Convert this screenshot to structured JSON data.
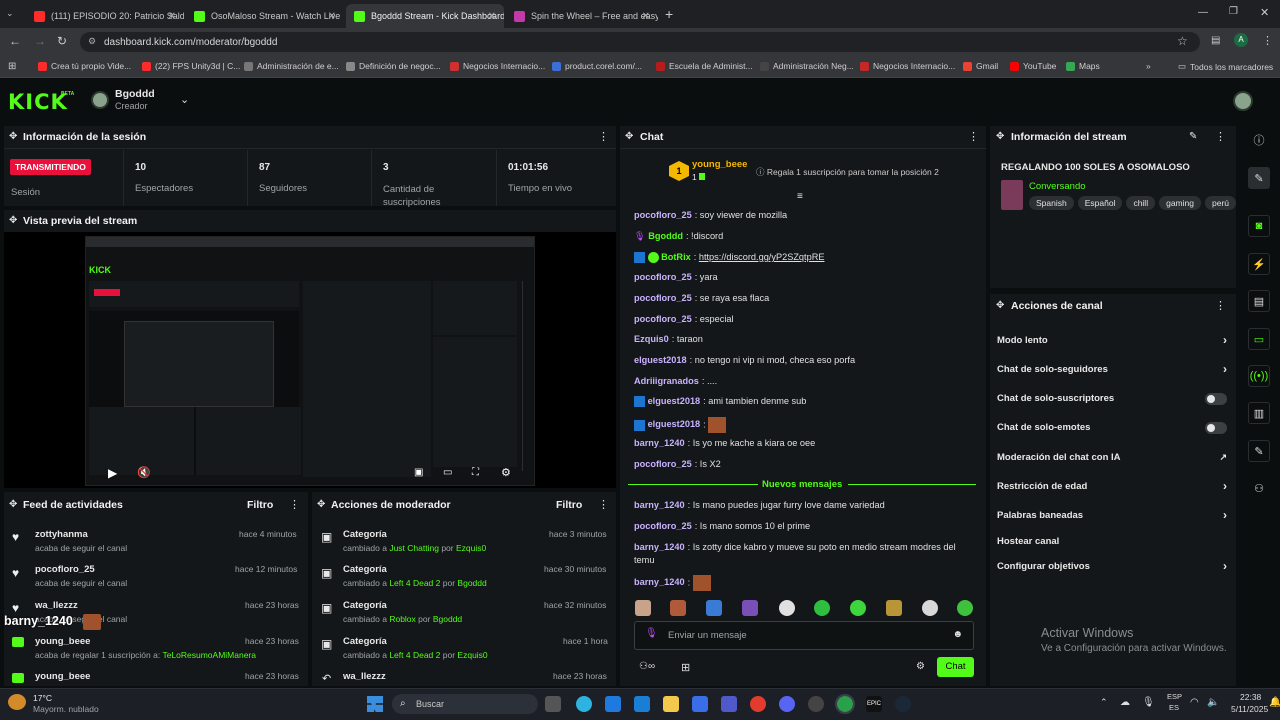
{
  "browser": {
    "tabs": [
      {
        "title": "(111) EPISODIO 20: Patricio Sald",
        "color": "#ff2b2b"
      },
      {
        "title": "OsoMaloso Stream - Watch Live",
        "color": "#53fc18"
      },
      {
        "title": "Bgoddd Stream - Kick Dashboard",
        "color": "#53fc18"
      },
      {
        "title": "Spin the Wheel – Free and easy",
        "color": "#c23aa8"
      }
    ],
    "url": "dashboard.kick.com/moderator/bgoddd",
    "bookmarks": [
      "Crea tú propio Vide...",
      "(22) FPS Unity3d | C...",
      "Administración de e...",
      "Definición de negoc...",
      "Negocios Internacio...",
      "product.corel.com/...",
      "Escuela de Administ...",
      "Administración Neg...",
      "Negocios Internacio...",
      "Gmail",
      "YouTube",
      "Maps"
    ],
    "bookmarks_folder": "Todos los marcadores"
  },
  "header": {
    "logo": "KICK",
    "logo_badge": "BETA",
    "user": "Bgoddd",
    "role": "Creador"
  },
  "session": {
    "title": "Información de la sesión",
    "status_badge": "TRANSMITIENDO",
    "status_label": "Sesión",
    "stats": [
      {
        "value": "10",
        "label": "Espectadores"
      },
      {
        "value": "87",
        "label": "Seguidores"
      },
      {
        "value": "3",
        "label": "Cantidad de suscripciones"
      },
      {
        "value": "01:01:56",
        "label": "Tiempo en vivo"
      }
    ]
  },
  "preview": {
    "title": "Vista previa del stream"
  },
  "chat": {
    "title": "Chat",
    "pinned": {
      "user": "young_beee",
      "rank": "1",
      "sub_count": "1",
      "text": "Regala 1 suscripción para tomar la posición 2"
    },
    "messages": [
      {
        "user": "pocofloro_25",
        "text": "soy viewer de mozilla",
        "color": "#c9b3ff"
      },
      {
        "user": "Bgoddd",
        "text": "!discord",
        "color": "#53fc18"
      },
      {
        "user": "BotRix",
        "text": "https://discord.gg/yP2SZqtpRE",
        "color": "#53fc18"
      },
      {
        "user": "pocofloro_25",
        "text": "yara",
        "color": "#c9b3ff"
      },
      {
        "user": "pocofloro_25",
        "text": "se raya esa flaca",
        "color": "#c9b3ff"
      },
      {
        "user": "pocofloro_25",
        "text": "especial",
        "color": "#c9b3ff"
      },
      {
        "user": "Ezquis0",
        "text": "taraon",
        "color": "#c9b3ff"
      },
      {
        "user": "elguest2018",
        "text": "no tengo ni vip ni mod, checa eso porfa",
        "color": "#c9b3ff"
      },
      {
        "user": "Adriiigranados",
        "text": "....",
        "color": "#c9b3ff"
      },
      {
        "user": "elguest2018",
        "text": "ami tambien denme sub",
        "color": "#c9b3ff"
      },
      {
        "user": "elguest2018",
        "text": "",
        "color": "#c9b3ff"
      },
      {
        "user": "barny_1240",
        "text": "Is yo me kache a kiara oe oee",
        "color": "#c9b3ff"
      },
      {
        "user": "pocofloro_25",
        "text": "Is X2",
        "color": "#c9b3ff"
      }
    ],
    "new_messages": "Nuevos mensajes",
    "messages_after": [
      {
        "user": "barny_1240",
        "text": "Is mano puedes jugar furry love dame variedad"
      },
      {
        "user": "pocofloro_25",
        "text": "Is mano somos 10 el prime"
      },
      {
        "user": "barny_1240",
        "text": "Is zotty dice kabro y mueve su poto en medio stream modres del"
      },
      {
        "user": "",
        "text": "temu"
      },
      {
        "user": "barny_1240",
        "text": ""
      }
    ],
    "input_placeholder": "Enviar un mensaje",
    "send_label": "Chat"
  },
  "stream_info": {
    "title": "Información del stream",
    "stream_title": "REGALANDO 100 SOLES A OSOMALOSO",
    "category": "Conversando",
    "tags": [
      "Spanish",
      "Español",
      "chill",
      "gaming",
      "perú"
    ]
  },
  "channel_actions": {
    "title": "Acciones de canal",
    "items": [
      {
        "label": "Modo lento",
        "control": "chevron"
      },
      {
        "label": "Chat de solo-seguidores",
        "control": "chevron"
      },
      {
        "label": "Chat de solo-suscriptores",
        "control": "toggle"
      },
      {
        "label": "Chat de solo-emotes",
        "control": "toggle"
      },
      {
        "label": "Moderación del chat con IA",
        "control": "external"
      },
      {
        "label": "Restricción de edad",
        "control": "chevron"
      },
      {
        "label": "Palabras baneadas",
        "control": "chevron"
      },
      {
        "label": "Hostear canal",
        "control": "none"
      },
      {
        "label": "Configurar objetivos",
        "control": "chevron"
      }
    ]
  },
  "activity": {
    "title": "Feed de actividades",
    "filter": "Filtro",
    "items": [
      {
        "user": "zottyhanma",
        "desc": "acaba de seguir el canal",
        "time": "hace 4 minutos"
      },
      {
        "user": "pocofloro_25",
        "desc": "acaba de seguir el canal",
        "time": "hace 12 minutos"
      },
      {
        "user": "wa_llezzz",
        "desc": "acaba de seguir el canal",
        "time": "hace 23 horas"
      },
      {
        "user": "young_beee",
        "desc": "acaba de regalar 1 suscripción a:",
        "extra": "TeLoResumoAMiManera",
        "time": "hace 23 horas"
      },
      {
        "user": "young_beee",
        "desc": "",
        "time": "hace 23 horas"
      }
    ],
    "overlay_user": "barny_1240"
  },
  "mod_actions": {
    "title": "Acciones de moderador",
    "filter": "Filtro",
    "items": [
      {
        "title": "Categoría",
        "pre": "cambiado a",
        "value": "Just Chatting",
        "by": "por",
        "user": "Ezquis0",
        "time": "hace 3 minutos"
      },
      {
        "title": "Categoría",
        "pre": "cambiado a",
        "value": "Left 4 Dead 2",
        "by": "por",
        "user": "Bgoddd",
        "time": "hace 30 minutos"
      },
      {
        "title": "Categoría",
        "pre": "cambiado a",
        "value": "Roblox",
        "by": "por",
        "user": "Bgoddd",
        "time": "hace 32 minutos"
      },
      {
        "title": "Categoría",
        "pre": "cambiado a",
        "value": "Left 4 Dead 2",
        "by": "por",
        "user": "Ezquis0",
        "time": "hace 1 hora"
      },
      {
        "title": "wa_llezzz",
        "pre": "",
        "value": "",
        "by": "",
        "user": "",
        "time": "hace 23 horas"
      }
    ]
  },
  "watermark": {
    "line1": "Activar Windows",
    "line2": "Ve a Configuración para activar Windows."
  },
  "taskbar": {
    "temp": "17°C",
    "weather": "Mayorm. nublado",
    "search": "Buscar",
    "lang1": "ESP",
    "lang2": "ES",
    "time": "22:38",
    "date": "5/11/2025"
  },
  "colors": {
    "accent": "#53fc18",
    "live": "#e9113c"
  }
}
